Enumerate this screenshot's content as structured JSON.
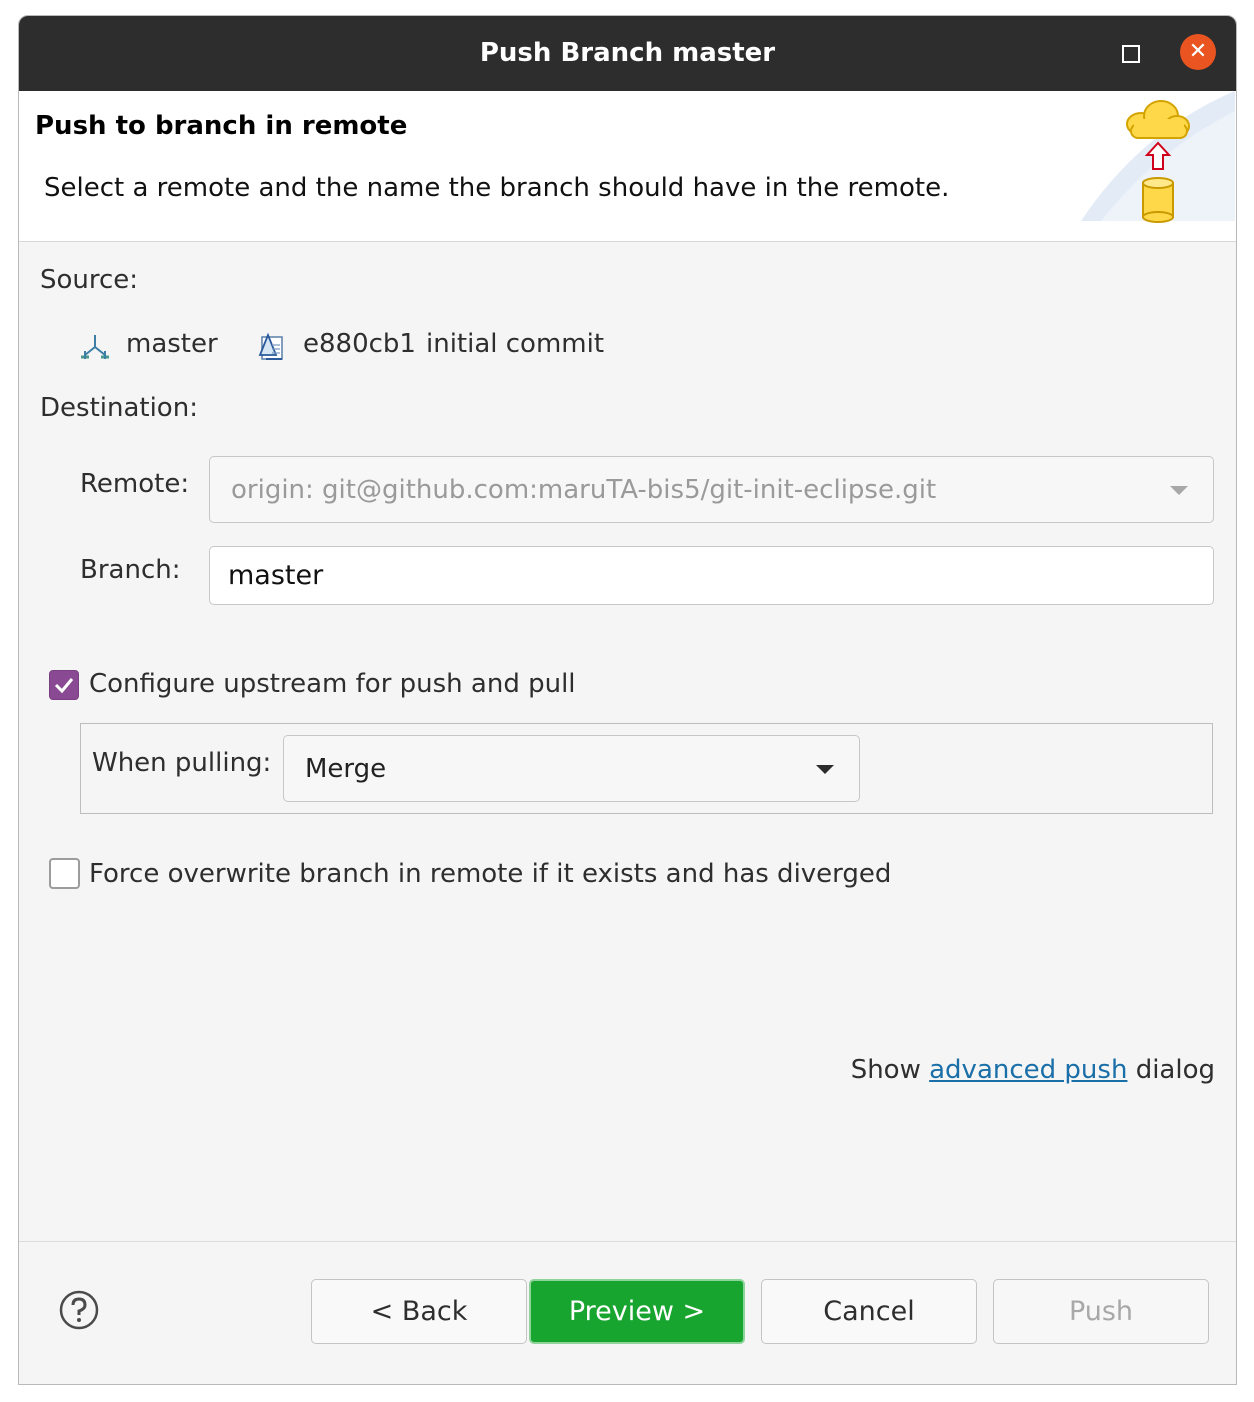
{
  "window": {
    "title": "Push Branch master"
  },
  "header": {
    "title": "Push to branch in remote",
    "description": "Select a remote and the name the branch should have in the remote."
  },
  "source": {
    "label": "Source:",
    "branch": "master",
    "commit_id": "e880cb1",
    "commit_message": "initial commit"
  },
  "destination": {
    "label": "Destination:",
    "remote_label": "Remote:",
    "remote_value": "origin: git@github.com:maruTA-bis5/git-init-eclipse.git",
    "branch_label": "Branch:",
    "branch_value": "master"
  },
  "upstream": {
    "checkbox_label": "Configure upstream for push and pull",
    "checked": true,
    "when_pulling_label": "When pulling:",
    "when_pulling_value": "Merge"
  },
  "force": {
    "checkbox_label": "Force overwrite branch in remote if it exists and has diverged",
    "checked": false
  },
  "advanced": {
    "prefix": "Show",
    "link": "advanced push",
    "suffix": "dialog"
  },
  "buttons": {
    "back": "< Back",
    "preview": "Preview >",
    "cancel": "Cancel",
    "push": "Push"
  },
  "icons": {
    "branch": "branch-icon",
    "commit": "commit-icon",
    "help": "help-icon",
    "banner": "push-banner-icon"
  },
  "colors": {
    "titlebar": "#2d2d2d",
    "close": "#e95420",
    "checkbox": "#8a4a93",
    "primary_button": "#17a530",
    "link": "#1a6fa8"
  }
}
